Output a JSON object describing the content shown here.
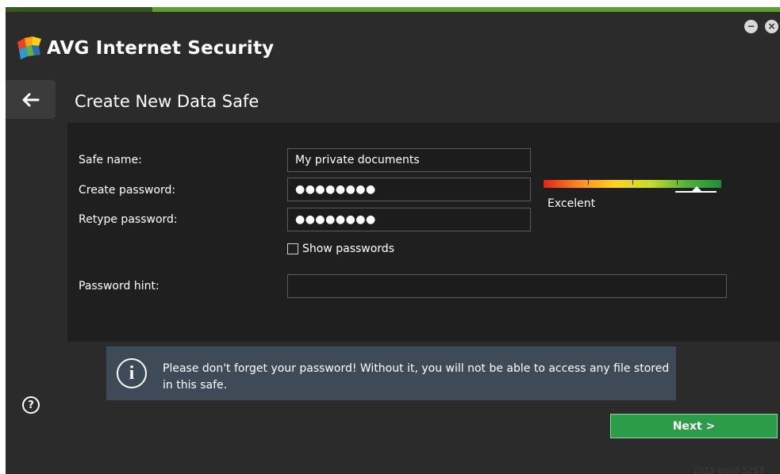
{
  "window": {
    "title": "AVG Internet Security",
    "minimize_symbol": "−",
    "close_symbol": "×"
  },
  "page": {
    "title": "Create New Data Safe",
    "back_icon": "arrow-left-icon"
  },
  "form": {
    "safe_name": {
      "label": "Safe name:",
      "value": "My private documents"
    },
    "create_password": {
      "label": "Create password:",
      "value": "●●●●●●●●"
    },
    "retype_password": {
      "label": "Retype password:",
      "value": "●●●●●●●●"
    },
    "show_passwords": {
      "label": "Show passwords",
      "checked": false
    },
    "password_hint": {
      "label": "Password hint:",
      "value": ""
    }
  },
  "password_strength": {
    "label": "Excelent",
    "level": 0.86
  },
  "info": {
    "text": "Please don't forget your password! Without it, you will not be able to access any file stored in this safe."
  },
  "actions": {
    "next_label": "Next >"
  },
  "footer": {
    "build": "2015 build 5253"
  },
  "colors": {
    "background": "#2b2b2b",
    "panel": "#1f1f1f",
    "accent_green": "#2b9d48",
    "info_box": "#3e4a57"
  }
}
